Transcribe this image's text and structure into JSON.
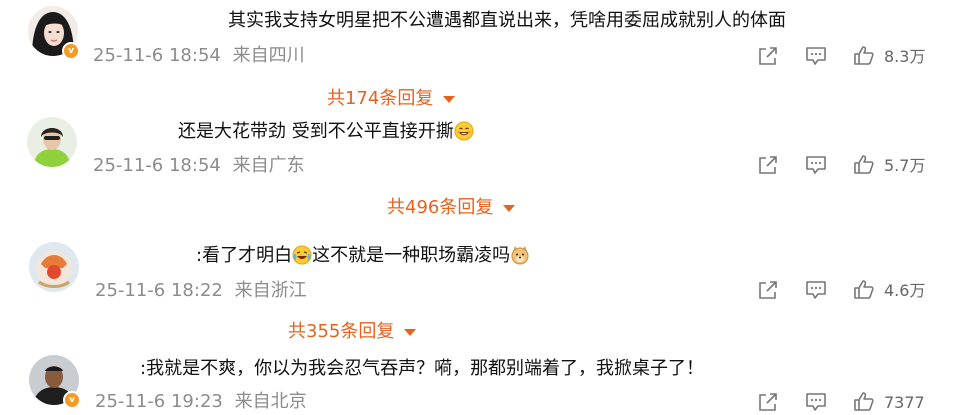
{
  "comments": [
    {
      "text": "其实我支持女明星把不公遭遇都直说出来，凭啥用委屈成就别人的体面",
      "date": "25-11-6 18:54",
      "location": "来自四川",
      "likes": "8.3万",
      "replies": "共174条回复",
      "verified": true
    },
    {
      "text_before": "还是大花带劲 受到不公平直接开撕",
      "emoji": "smile-emoji",
      "date": "25-11-6 18:54",
      "location": "来自广东",
      "likes": "5.7万",
      "replies": "共496条回复",
      "verified": false
    },
    {
      "text_before": ":看了才明白",
      "emoji1": "crying-laugh-emoji",
      "text_mid": "这不就是一种职场霸凌吗",
      "emoji2": "doge-emoji",
      "date": "25-11-6 18:22",
      "location": "来自浙江",
      "likes": "4.6万",
      "replies": "共355条回复",
      "verified": false
    },
    {
      "text": ":我就是不爽，你以为我会忍气吞声？嗬，那都别端着了，我掀桌子了！",
      "date": "25-11-6 19:23",
      "location": "来自北京",
      "likes": "7377",
      "verified": true
    }
  ],
  "colors": {
    "accent": "#e4631f",
    "meta": "#8c8c8c",
    "badge": "#f59a23"
  }
}
